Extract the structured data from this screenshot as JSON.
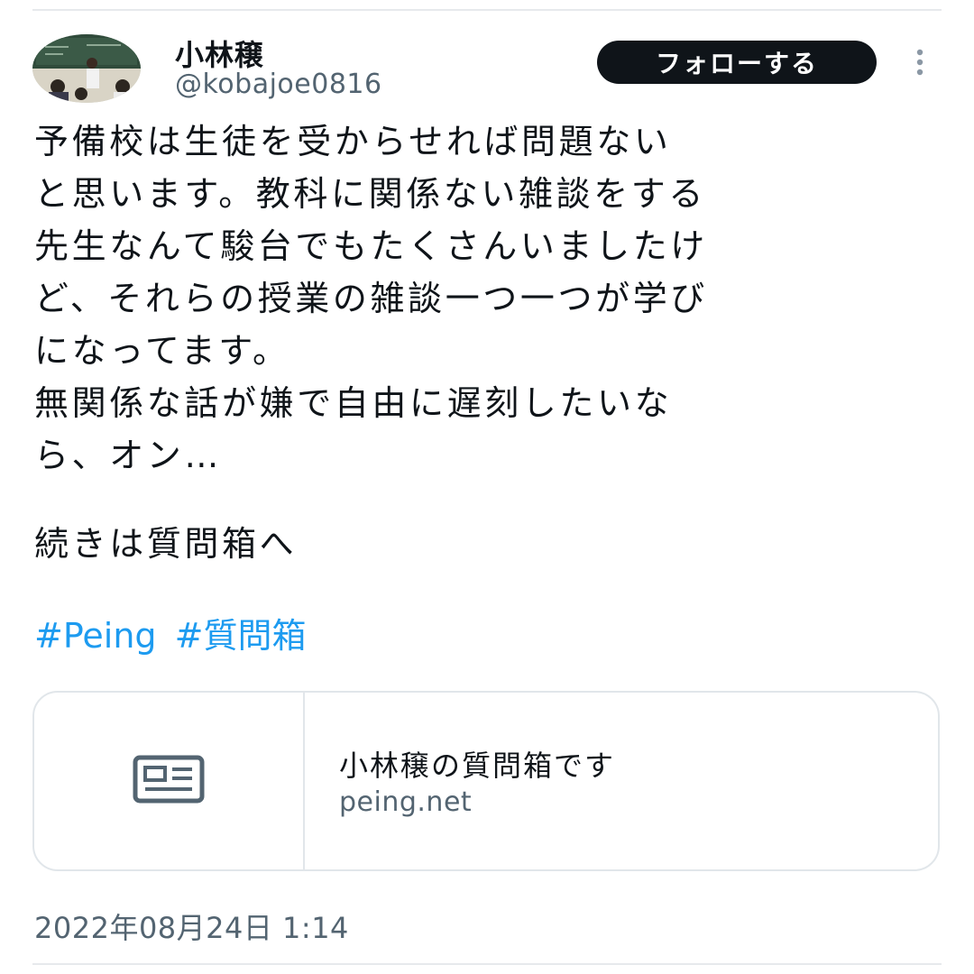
{
  "tweet": {
    "author": {
      "display_name": "小林穣",
      "handle": "@kobajoe0816"
    },
    "follow_label": "フォローする",
    "body_lines": [
      "予備校は生徒を受からせれば問題ない",
      "と思います。教科に関係ない雑談をする",
      "先生なんて駿台でもたくさんいましたけ",
      "ど、それらの授業の雑談一つ一つが学び",
      "になってます。",
      "無関係な話が嫌で自由に遅刻したいな",
      "ら、オン…"
    ],
    "continue_text": "続きは質問箱へ",
    "hashtags": [
      "#Peing",
      "#質問箱"
    ],
    "link_card": {
      "title": "小林穣の質問箱です",
      "domain": "peing.net",
      "thumbnail_icon": "article-icon"
    },
    "timestamp": "2022年08月24日 1:14"
  },
  "colors": {
    "text_primary": "#0f1419",
    "text_secondary": "#536471",
    "hashtag_blue": "#1d9bf0",
    "button_bg": "#0f1419",
    "border": "#e1e6ea"
  },
  "icons": {
    "more": "more-vertical-icon",
    "card_thumb": "article-icon"
  }
}
